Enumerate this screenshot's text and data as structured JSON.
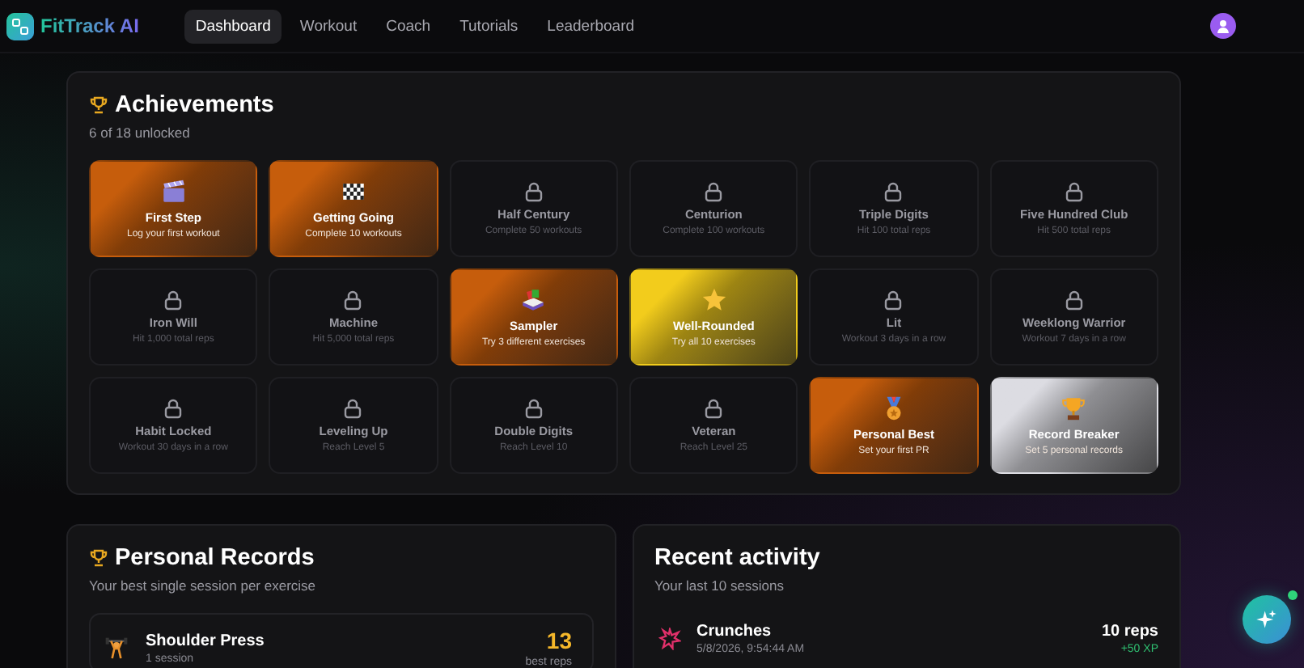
{
  "app": {
    "name": "FitTrack AI"
  },
  "nav": [
    {
      "label": "Dashboard",
      "selected": true
    },
    {
      "label": "Workout",
      "selected": false
    },
    {
      "label": "Coach",
      "selected": false
    },
    {
      "label": "Tutorials",
      "selected": false
    },
    {
      "label": "Leaderboard",
      "selected": false
    }
  ],
  "achievements": {
    "title": "Achievements",
    "subtitle": "6 of 18 unlocked",
    "items": [
      {
        "name": "First Step",
        "desc": "Log your first workout",
        "unlocked": true,
        "color": "#c65d0c"
      },
      {
        "name": "Getting Going",
        "desc": "Complete 10 workouts",
        "unlocked": true,
        "color": "#c65d0c"
      },
      {
        "name": "Half Century",
        "desc": "Complete 50 workouts",
        "unlocked": false
      },
      {
        "name": "Centurion",
        "desc": "Complete 100 workouts",
        "unlocked": false
      },
      {
        "name": "Triple Digits",
        "desc": "Hit 100 total reps",
        "unlocked": false
      },
      {
        "name": "Five Hundred Club",
        "desc": "Hit 500 total reps",
        "unlocked": false
      },
      {
        "name": "Iron Will",
        "desc": "Hit 1,000 total reps",
        "unlocked": false
      },
      {
        "name": "Machine",
        "desc": "Hit 5,000 total reps",
        "unlocked": false
      },
      {
        "name": "Sampler",
        "desc": "Try 3 different exercises",
        "unlocked": true,
        "color": "#c65d0c"
      },
      {
        "name": "Well-Rounded",
        "desc": "Try all 10 exercises",
        "unlocked": true,
        "color": "#f2cc1c"
      },
      {
        "name": "Lit",
        "desc": "Workout 3 days in a row",
        "unlocked": false
      },
      {
        "name": "Weeklong Warrior",
        "desc": "Workout 7 days in a row",
        "unlocked": false
      },
      {
        "name": "Habit Locked",
        "desc": "Workout 30 days in a row",
        "unlocked": false
      },
      {
        "name": "Leveling Up",
        "desc": "Reach Level 5",
        "unlocked": false
      },
      {
        "name": "Double Digits",
        "desc": "Reach Level 10",
        "unlocked": false
      },
      {
        "name": "Veteran",
        "desc": "Reach Level 25",
        "unlocked": false
      },
      {
        "name": "Personal Best",
        "desc": "Set your first PR",
        "unlocked": true,
        "color": "#c65d0c"
      },
      {
        "name": "Record Breaker",
        "desc": "Set 5 personal records",
        "unlocked": true,
        "color": "#dcdce2"
      }
    ]
  },
  "personal_records": {
    "title": "Personal Records",
    "subtitle": "Your best single session per exercise",
    "rows": [
      {
        "exercise": "Shoulder Press",
        "sessions": "1 session",
        "value": "13",
        "unit": "best reps"
      }
    ]
  },
  "recent_activity": {
    "title": "Recent activity",
    "subtitle": "Your last 10 sessions",
    "rows": [
      {
        "exercise": "Crunches",
        "time": "5/8/2026, 9:54:44 AM",
        "reps": "10 reps",
        "xp": "+50 XP"
      }
    ]
  }
}
